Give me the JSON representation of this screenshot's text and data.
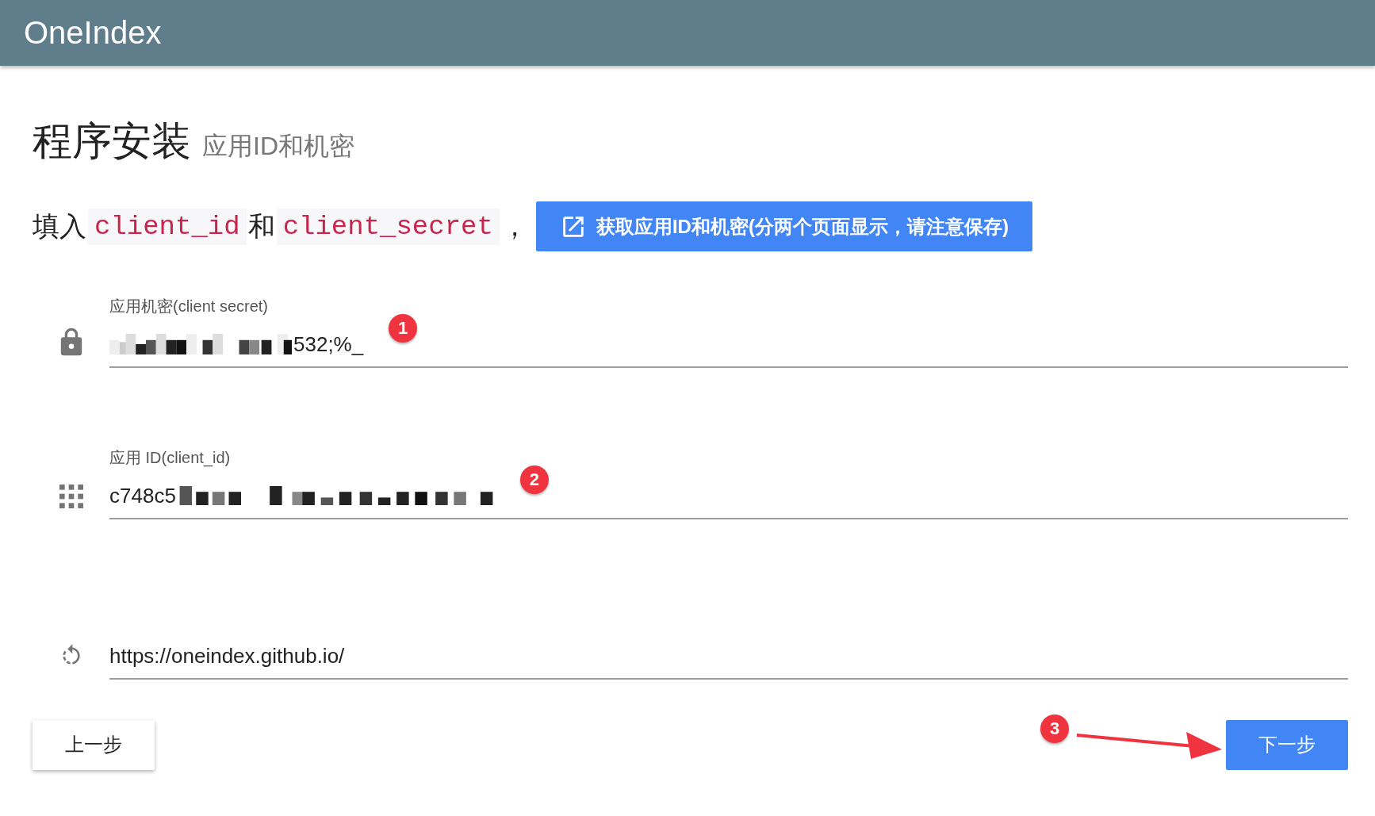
{
  "app_bar": {
    "title": "OneIndex"
  },
  "heading": {
    "title": "程序安装",
    "subtitle": "应用ID和机密"
  },
  "instruction": {
    "parts": [
      {
        "kind": "text",
        "text": "填入"
      },
      {
        "kind": "code",
        "text": "client_id"
      },
      {
        "kind": "text",
        "text": "和"
      },
      {
        "kind": "code",
        "text": "client_secret"
      },
      {
        "kind": "text",
        "text": "，"
      }
    ],
    "link_button": "获取应用ID和机密(分两个页面显示，请注意保存)"
  },
  "fields": [
    {
      "kind": "secret",
      "label": "应用机密(client secret)",
      "value": "532;%_",
      "annotation": "1"
    },
    {
      "kind": "id",
      "label": "应用 ID(client_id)",
      "value": "c748c5",
      "annotation": "2"
    },
    {
      "kind": "url",
      "value": "https://oneindex.github.io/"
    }
  ],
  "buttons": [
    {
      "label": "上一步",
      "kind": "secondary"
    },
    {
      "label": "下一步",
      "kind": "primary",
      "annotation": "3"
    }
  ]
}
